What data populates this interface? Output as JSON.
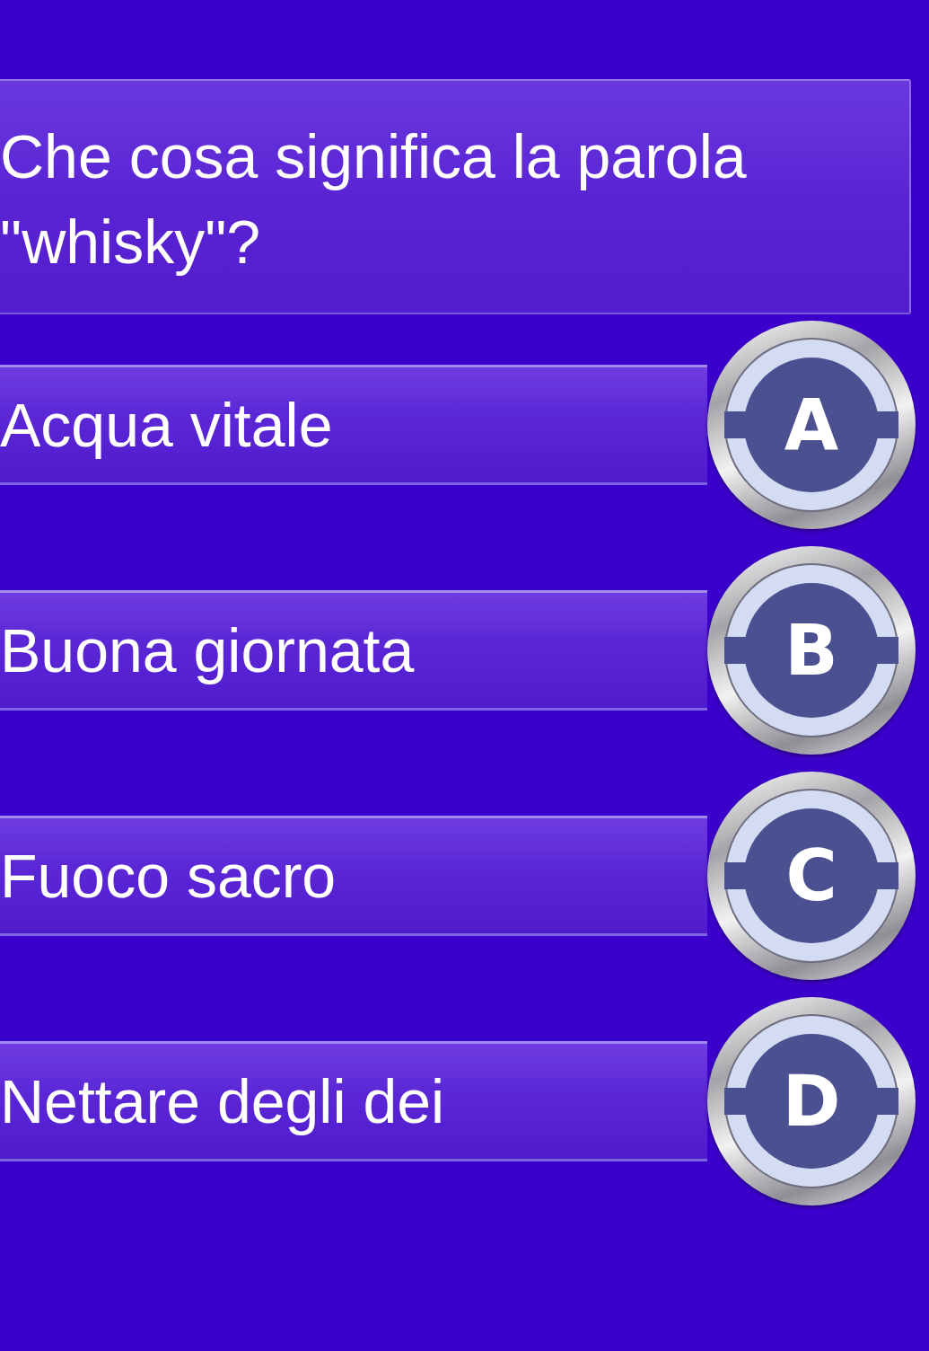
{
  "question": {
    "text": "Che cosa significa la parola \"whisky\"?"
  },
  "answers": [
    {
      "letter": "A",
      "text": "Acqua vitale"
    },
    {
      "letter": "B",
      "text": "Buona giornata"
    },
    {
      "letter": "C",
      "text": "Fuoco sacro"
    },
    {
      "letter": "D",
      "text": "Nettare degli dei"
    }
  ]
}
